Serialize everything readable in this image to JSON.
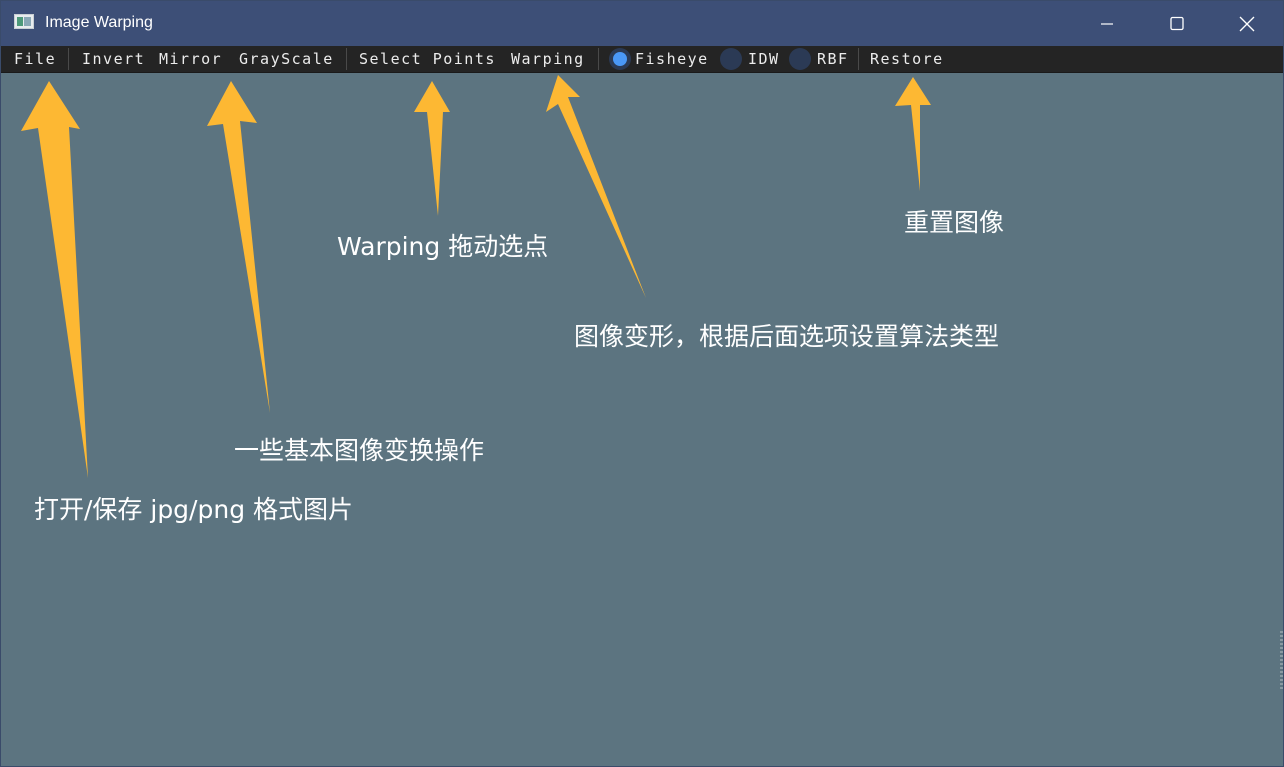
{
  "window": {
    "title": "Image Warping",
    "controls": {
      "minimize": "minimize-icon",
      "maximize": "maximize-icon",
      "close": "close-icon"
    }
  },
  "menubar": {
    "file": "File",
    "invert": "Invert",
    "mirror": "Mirror",
    "grayscale": "GrayScale",
    "select_points": "Select Points",
    "warping": "Warping",
    "algorithms": [
      {
        "label": "Fisheye",
        "selected": true
      },
      {
        "label": "IDW",
        "selected": false
      },
      {
        "label": "RBF",
        "selected": false
      }
    ],
    "restore": "Restore"
  },
  "annotations": {
    "restore_note": "重置图像",
    "select_note": "Warping 拖动选点",
    "warping_note": "图像变形，根据后面选项设置算法类型",
    "basic_ops_note": "一些基本图像变换操作",
    "file_note": "打开/保存 jpg/png 格式图片"
  },
  "colors": {
    "titlebar": "#3d4f77",
    "menubar": "#242424",
    "canvas": "#5c7480",
    "arrow": "#fdb833",
    "radio_selected": "#4a98f7",
    "radio_unselected": "#2b3a55"
  }
}
